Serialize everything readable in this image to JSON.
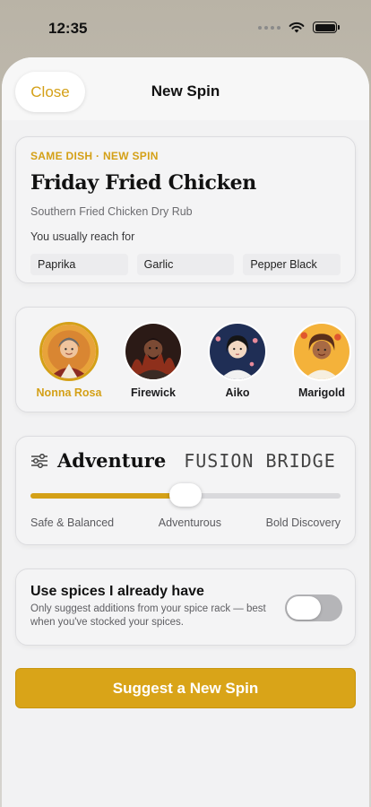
{
  "status_bar": {
    "time": "12:35"
  },
  "nav": {
    "close_label": "Close",
    "title": "New Spin"
  },
  "dish": {
    "eyebrow": "SAME DISH · NEW SPIN",
    "title": "Friday Fried Chicken",
    "subtitle": "Southern Fried Chicken Dry Rub",
    "reach_label": "You usually reach for",
    "spices": [
      "Paprika",
      "Garlic",
      "Pepper Black"
    ]
  },
  "chefs": [
    {
      "name": "Nonna Rosa",
      "selected": true
    },
    {
      "name": "Firewick",
      "selected": false
    },
    {
      "name": "Aiko",
      "selected": false
    },
    {
      "name": "Marigold",
      "selected": false
    }
  ],
  "adventure": {
    "title": "Adventure",
    "mode": "FUSION BRIDGE",
    "level": 0.5,
    "labels": {
      "low": "Safe & Balanced",
      "mid": "Adventurous",
      "high": "Bold Discovery"
    }
  },
  "spice_option": {
    "title": "Use spices I already have",
    "description": "Only suggest additions from your spice rack — best when you've stocked your spices.",
    "enabled": false
  },
  "suggest_button": "Suggest a New Spin",
  "colors": {
    "accent": "#d4a017",
    "button": "#d9a418"
  }
}
